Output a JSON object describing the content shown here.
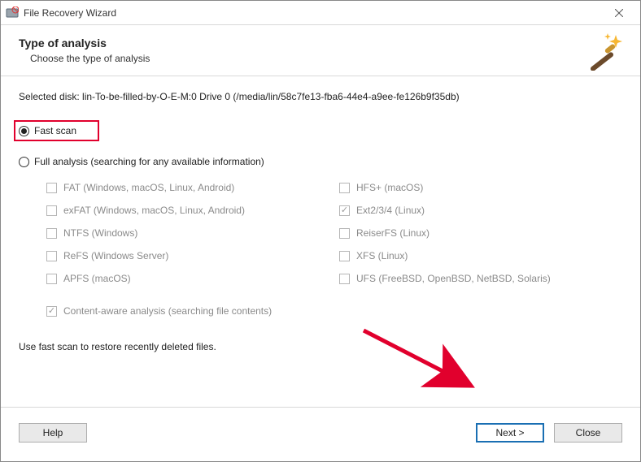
{
  "window": {
    "title": "File Recovery Wizard"
  },
  "header": {
    "heading": "Type of analysis",
    "subheading": "Choose the type of analysis"
  },
  "selected_disk": "Selected disk: lin-To-be-filled-by-O-E-M:0 Drive 0 (/media/lin/58c7fe13-fba6-44e4-a9ee-fe126b9f35db)",
  "options": {
    "fast_scan": {
      "label": "Fast scan",
      "selected": true
    },
    "full_analysis": {
      "label": "Full analysis (searching for any available information)",
      "selected": false
    }
  },
  "filesystems_left": [
    {
      "label": "FAT (Windows, macOS, Linux, Android)",
      "checked": false
    },
    {
      "label": "exFAT (Windows, macOS, Linux, Android)",
      "checked": false
    },
    {
      "label": "NTFS (Windows)",
      "checked": false
    },
    {
      "label": "ReFS (Windows Server)",
      "checked": false
    },
    {
      "label": "APFS (macOS)",
      "checked": false
    }
  ],
  "filesystems_right": [
    {
      "label": "HFS+ (macOS)",
      "checked": false
    },
    {
      "label": "Ext2/3/4 (Linux)",
      "checked": true
    },
    {
      "label": "ReiserFS (Linux)",
      "checked": false
    },
    {
      "label": "XFS (Linux)",
      "checked": false
    },
    {
      "label": "UFS (FreeBSD, OpenBSD, NetBSD, Solaris)",
      "checked": false
    }
  ],
  "content_aware": {
    "label": "Content-aware analysis (searching file contents)",
    "checked": true
  },
  "hint": "Use fast scan to restore recently deleted files.",
  "buttons": {
    "help": "Help",
    "next": "Next >",
    "close": "Close"
  },
  "annotation": {
    "fast_scan_highlighted": true,
    "arrow_to_next": true
  }
}
